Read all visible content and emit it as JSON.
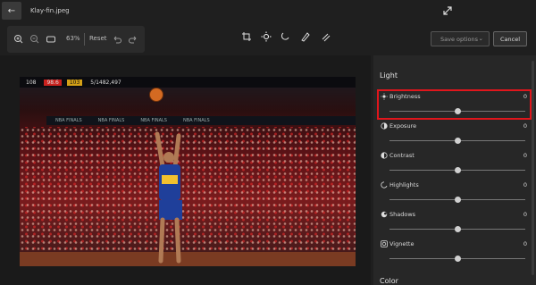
{
  "window": {
    "file_title": "Klay-fin.jpeg"
  },
  "toolbar": {
    "zoom_level": "63%",
    "reset_label": "Reset",
    "save_options_label": "Save options",
    "cancel_label": "Cancel"
  },
  "photo": {
    "scoreboard": [
      "108",
      "98.6",
      "103",
      "5/1482,497"
    ],
    "led_texts": [
      "NBA FINALS",
      "NBA FINALS",
      "NBA FINALS",
      "NBA FINALS"
    ]
  },
  "panel": {
    "section_light": "Light",
    "section_color": "Color",
    "adjustments": [
      {
        "label": "Brightness",
        "value": "0",
        "icon": "sun-icon",
        "level": 0.5
      },
      {
        "label": "Exposure",
        "value": "0",
        "icon": "exposure-icon",
        "level": 0.5
      },
      {
        "label": "Contrast",
        "value": "0",
        "icon": "contrast-icon",
        "level": 0.5
      },
      {
        "label": "Highlights",
        "value": "0",
        "icon": "highlights-icon",
        "level": 0.5
      },
      {
        "label": "Shadows",
        "value": "0",
        "icon": "shadows-icon",
        "level": 0.5
      },
      {
        "label": "Vignette",
        "value": "0",
        "icon": "vignette-icon",
        "level": 0.5
      }
    ]
  },
  "colors": {
    "accent_selected": "#e0161c",
    "panel_bg": "#272727"
  }
}
